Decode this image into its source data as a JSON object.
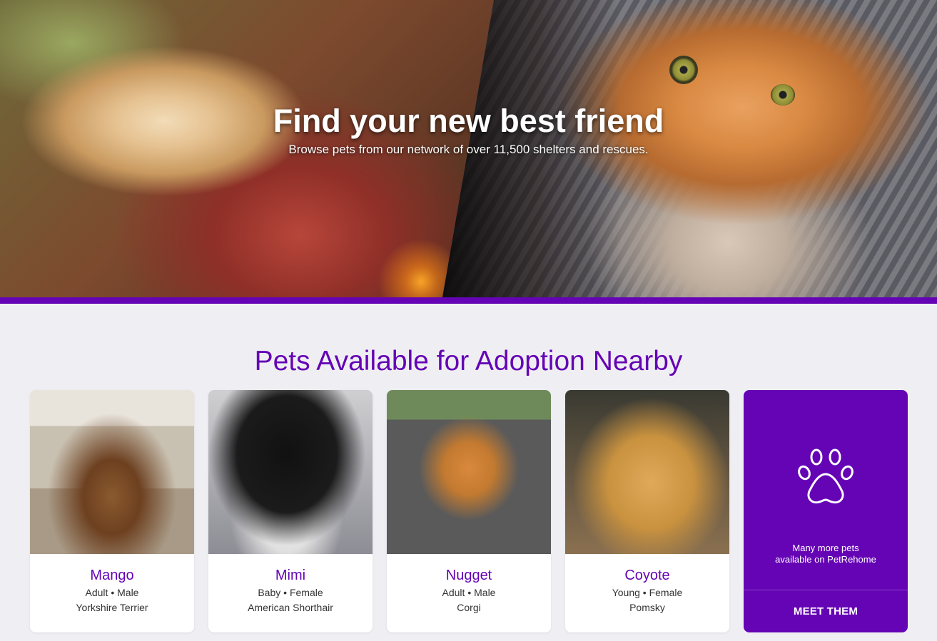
{
  "hero": {
    "title": "Find your new best friend",
    "subtitle": "Browse pets from our network of over 11,500 shelters and rescues."
  },
  "section": {
    "title": "Pets Available for Adoption Nearby"
  },
  "pets": [
    {
      "name": "Mango",
      "age": "Adult",
      "gender": "Male",
      "breed": "Yorkshire Terrier"
    },
    {
      "name": "Mimi",
      "age": "Baby",
      "gender": "Female",
      "breed": "American Shorthair"
    },
    {
      "name": "Nugget",
      "age": "Adult",
      "gender": "Male",
      "breed": "Corgi"
    },
    {
      "name": "Coyote",
      "age": "Young",
      "gender": "Female",
      "breed": "Pomsky"
    }
  ],
  "more": {
    "text_line1": "Many more pets",
    "text_line2": "available on PetRehome",
    "button_label": "MEET THEM",
    "icon": "paw-icon"
  },
  "colors": {
    "brand_purple": "#6504b5",
    "page_bg": "#efeff3"
  }
}
